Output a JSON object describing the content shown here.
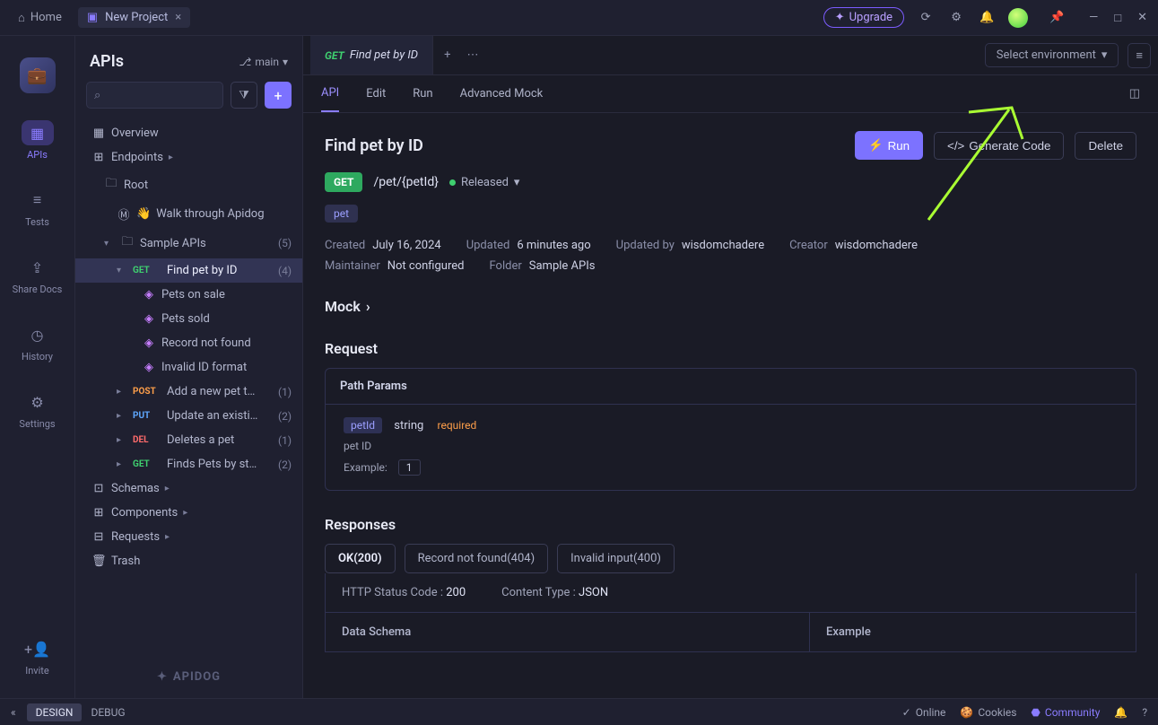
{
  "titlebar": {
    "home": "Home",
    "project": "New Project",
    "upgrade": "Upgrade"
  },
  "rail": {
    "apis": "APIs",
    "tests": "Tests",
    "share": "Share Docs",
    "history": "History",
    "settings": "Settings",
    "invite": "Invite"
  },
  "sidebar": {
    "title": "APIs",
    "branch": "main",
    "overview": "Overview",
    "endpoints": "Endpoints",
    "root": "Root",
    "walkthrough": "Walk through Apidog",
    "sample": {
      "label": "Sample APIs",
      "count": "(5)"
    },
    "findpet": {
      "label": "Find pet by ID",
      "count": "(4)"
    },
    "mocks": [
      "Pets on sale",
      "Pets sold",
      "Record not found",
      "Invalid ID format"
    ],
    "post": {
      "label": "Add a new pet t…",
      "count": "(1)"
    },
    "put": {
      "label": "Update an existi…",
      "count": "(2)"
    },
    "del": {
      "label": "Deletes a pet",
      "count": "(1)"
    },
    "get2": {
      "label": "Finds Pets by st…",
      "count": "(2)"
    },
    "schemas": "Schemas",
    "components": "Components",
    "requests": "Requests",
    "trash": "Trash",
    "brand": "APIDOG"
  },
  "tabs": {
    "current_method": "GET",
    "current_label": "Find pet by ID",
    "env": "Select environment"
  },
  "subtabs": {
    "api": "API",
    "edit": "Edit",
    "run": "Run",
    "mock": "Advanced Mock"
  },
  "doc": {
    "title": "Find pet by ID",
    "run": "Run",
    "gen": "Generate Code",
    "delete": "Delete",
    "method": "GET",
    "path": "/pet/{petId}",
    "status": "Released",
    "tag": "pet",
    "created_l": "Created",
    "created_v": "July 16, 2024",
    "updated_l": "Updated",
    "updated_v": "6 minutes ago",
    "updatedby_l": "Updated by",
    "updatedby_v": "wisdomchadere",
    "creator_l": "Creator",
    "creator_v": "wisdomchadere",
    "maintainer_l": "Maintainer",
    "maintainer_v": "Not configured",
    "folder_l": "Folder",
    "folder_v": "Sample APIs",
    "mock_h": "Mock",
    "request_h": "Request",
    "path_params": "Path Params",
    "param_name": "petId",
    "param_type": "string",
    "param_req": "required",
    "param_desc": "pet ID",
    "param_example_l": "Example:",
    "param_example_v": "1",
    "responses_h": "Responses",
    "resp_tabs": [
      "OK(200)",
      "Record not found(404)",
      "Invalid input(400)"
    ],
    "http_code_l": "HTTP Status Code :",
    "http_code_v": "200",
    "content_type_l": "Content Type :",
    "content_type_v": "JSON",
    "schema_l": "Data Schema",
    "example_l": "Example"
  },
  "footer": {
    "design": "DESIGN",
    "debug": "DEBUG",
    "online": "Online",
    "cookies": "Cookies",
    "community": "Community"
  }
}
